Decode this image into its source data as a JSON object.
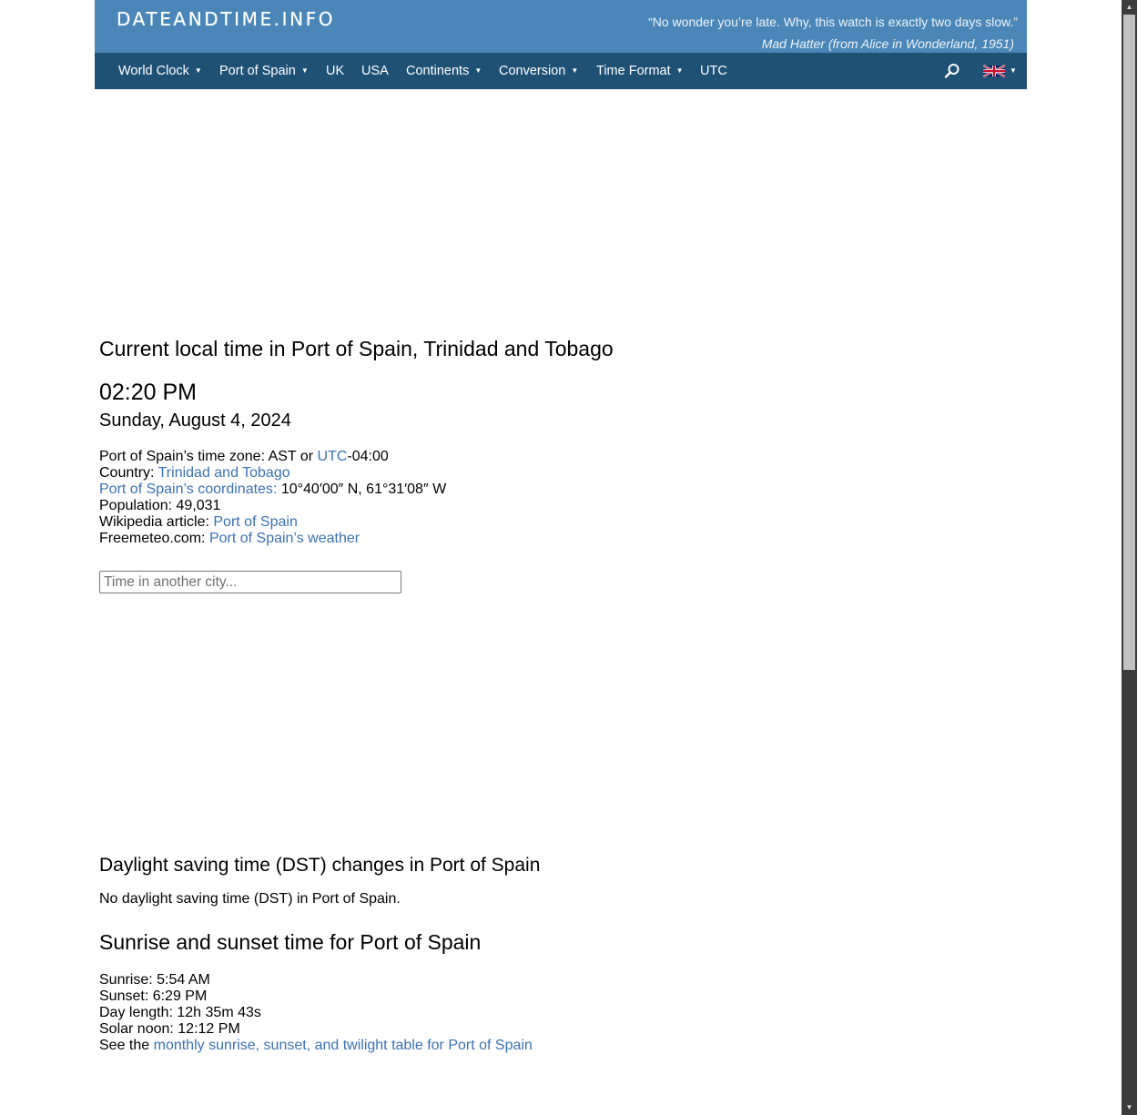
{
  "header": {
    "logo": "DATEANDTIME.INFO",
    "quote": "“No wonder you’re late. Why, this watch is exactly two days slow.”",
    "quote_attribution": "Mad Hatter (from Alice in Wonderland, 1951)"
  },
  "nav": {
    "items": [
      {
        "label": "World Clock",
        "dropdown": true
      },
      {
        "label": "Port of Spain",
        "dropdown": true
      },
      {
        "label": "UK",
        "dropdown": false
      },
      {
        "label": "USA",
        "dropdown": false
      },
      {
        "label": "Continents",
        "dropdown": true
      },
      {
        "label": "Conversion",
        "dropdown": true
      },
      {
        "label": "Time Format",
        "dropdown": true
      },
      {
        "label": "UTC",
        "dropdown": false
      }
    ],
    "search_icon": "search-icon",
    "language_icon": "uk-flag-icon"
  },
  "main": {
    "title": "Current local time in Port of Spain, Trinidad and Tobago",
    "time": "02:20 PM",
    "date": "Sunday, August 4, 2024",
    "timezone_label": "Port of Spain’s time zone: AST or ",
    "timezone_link": "UTC",
    "timezone_offset": "-04:00",
    "country_label": "Country: ",
    "country_link": "Trinidad and Tobago",
    "coords_link": "Port of Spain’s coordinates:",
    "coords_value": " 10°40′00″ N, 61°31′08″ W",
    "population": "Population: 49,031",
    "wiki_label": "Wikipedia article: ",
    "wiki_link": "Port of Spain",
    "freemeteo_label": "Freemeteo.com: ",
    "freemeteo_link": "Port of Spain’s weather",
    "city_search_placeholder": "Time in another city..."
  },
  "dst": {
    "title": "Daylight saving time (DST) changes in Port of Spain",
    "text": "No daylight saving time (DST) in Port of Spain."
  },
  "sun": {
    "title": "Sunrise and sunset time for Port of Spain",
    "sunrise": "Sunrise: 5:54 AM",
    "sunset": "Sunset: 6:29 PM",
    "day_length": "Day length: 12h 35m 43s",
    "solar_noon": "Solar noon: 12:12 PM",
    "see_label": "See the ",
    "see_link": "monthly sunrise, sunset, and twilight table for Port of Spain"
  }
}
